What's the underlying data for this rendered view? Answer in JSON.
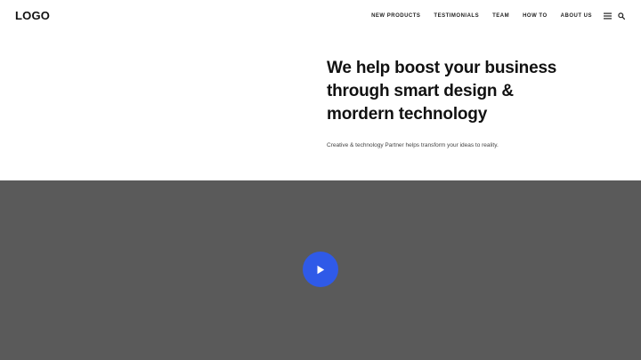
{
  "header": {
    "logo": "LOGO",
    "nav": [
      {
        "label": "NEW PRODUCTS"
      },
      {
        "label": "TESTIMONIALS"
      },
      {
        "label": "TEAM"
      },
      {
        "label": "HOW TO"
      },
      {
        "label": "ABOUT US"
      }
    ],
    "icons": [
      "menu-icon",
      "search-icon"
    ]
  },
  "hero": {
    "title_lines": [
      "We help boost your business",
      "through smart design &",
      "mordern technology"
    ],
    "subtitle": "Creative & technology Partner helps transform your ideas to reality."
  },
  "video": {
    "background_color": "#5a5a5a",
    "play_button_color": "#2f5ae8",
    "play_icon": "play-icon"
  }
}
